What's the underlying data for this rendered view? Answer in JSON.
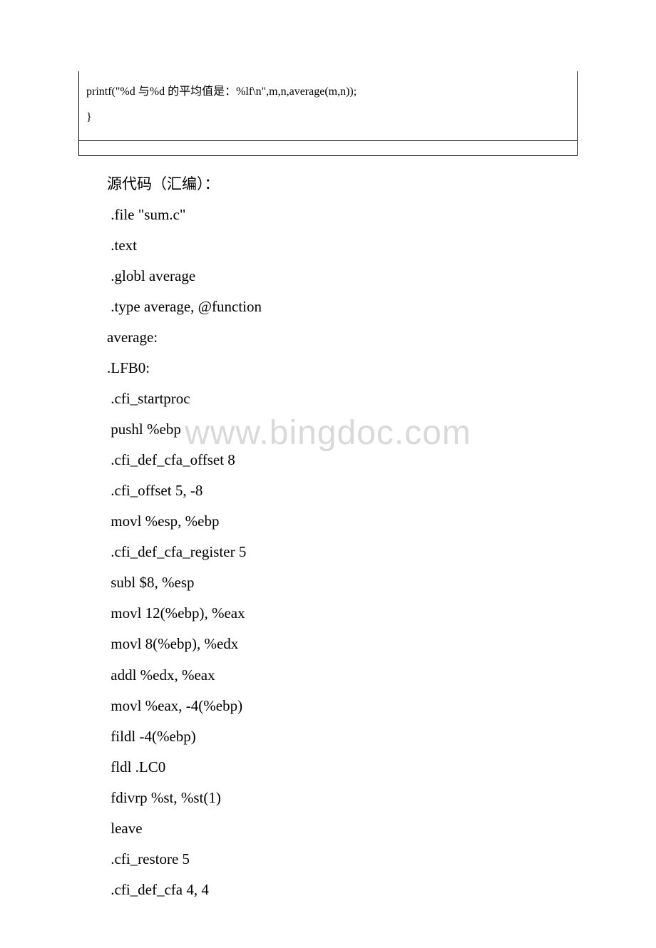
{
  "watermark": "www.bingdoc.com",
  "codebox": {
    "line1": "  printf(\"%d 与%d 的平均值是：%lf\\n\",m,n,average(m,n));",
    "line2": "}"
  },
  "heading": "源代码（汇编）：",
  "lines": [
    " .file \"sum.c\"",
    " .text",
    " .globl average",
    " .type average, @function",
    "average:",
    ".LFB0:",
    " .cfi_startproc",
    " pushl %ebp",
    " .cfi_def_cfa_offset 8",
    " .cfi_offset 5, -8",
    " movl %esp, %ebp",
    " .cfi_def_cfa_register 5",
    " subl $8, %esp",
    " movl 12(%ebp), %eax",
    " movl 8(%ebp), %edx",
    " addl %edx, %eax",
    " movl %eax, -4(%ebp)",
    " fildl -4(%ebp)",
    " fldl .LC0",
    " fdivrp %st, %st(1)",
    " leave",
    " .cfi_restore 5",
    " .cfi_def_cfa 4, 4"
  ]
}
